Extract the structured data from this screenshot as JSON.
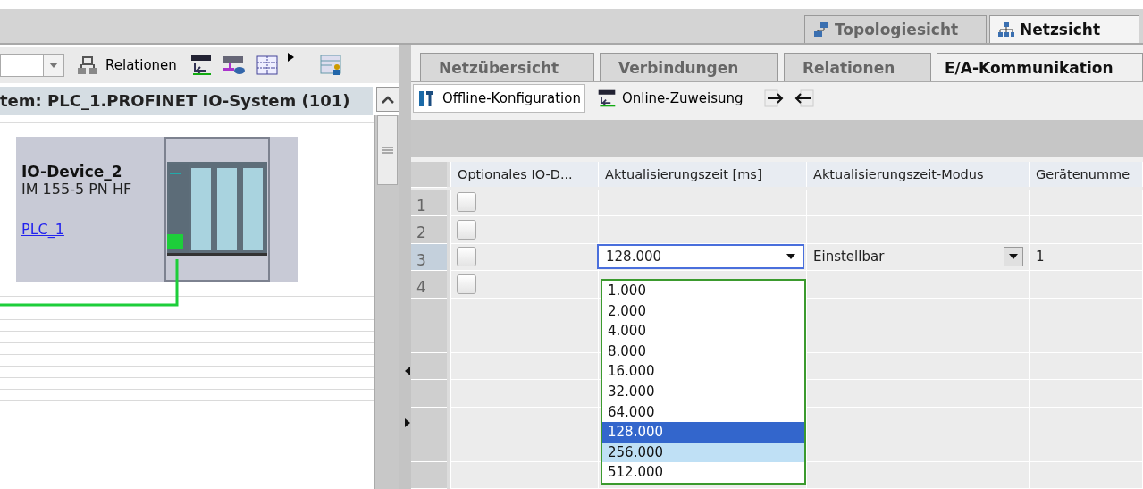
{
  "view_tabs": [
    {
      "label": "Topologiesicht",
      "selected": false
    },
    {
      "label": "Netzsicht",
      "selected": true
    }
  ],
  "left_panel": {
    "toolbar": {
      "relations_button": "Relationen"
    },
    "header": "tem: PLC_1.PROFINET IO-System (101)",
    "device": {
      "name": "IO-Device_2",
      "type": "IM 155-5 PN HF",
      "plc_link": "PLC_1"
    }
  },
  "right_panel": {
    "tabs": [
      {
        "label": "Netzübersicht",
        "selected": false
      },
      {
        "label": "Verbindungen",
        "selected": false
      },
      {
        "label": "Relationen",
        "selected": false
      },
      {
        "label": "E/A-Kommunikation",
        "selected": true
      }
    ],
    "toolbar": [
      {
        "label": "Offline-Konfiguration",
        "selected": true
      },
      {
        "label": "Online-Zuweisung",
        "selected": false
      }
    ],
    "table": {
      "columns": [
        "Optionales IO-D...",
        "Aktualisierungszeit [ms]",
        "Aktualisierungszeit-Modus",
        "Gerätenumme"
      ],
      "rows": [
        {
          "number": "1",
          "checked": false,
          "selected": false
        },
        {
          "number": "2",
          "checked": false,
          "selected": false
        },
        {
          "number": "3",
          "checked": false,
          "selected": true,
          "update_time": "128.000",
          "mode": "Einstellbar",
          "device_number": "1"
        },
        {
          "number": "4",
          "checked": false,
          "selected": false
        }
      ]
    },
    "dropdown": {
      "options": [
        {
          "label": "1.000",
          "selected": false,
          "highlighted": false
        },
        {
          "label": "2.000",
          "selected": false,
          "highlighted": false
        },
        {
          "label": "4.000",
          "selected": false,
          "highlighted": false
        },
        {
          "label": "8.000",
          "selected": false,
          "highlighted": false
        },
        {
          "label": "16.000",
          "selected": false,
          "highlighted": false
        },
        {
          "label": "32.000",
          "selected": false,
          "highlighted": false
        },
        {
          "label": "64.000",
          "selected": false,
          "highlighted": false
        },
        {
          "label": "128.000",
          "selected": true,
          "highlighted": false
        },
        {
          "label": "256.000",
          "selected": false,
          "highlighted": true
        },
        {
          "label": "512.000",
          "selected": false,
          "highlighted": false
        }
      ]
    }
  }
}
